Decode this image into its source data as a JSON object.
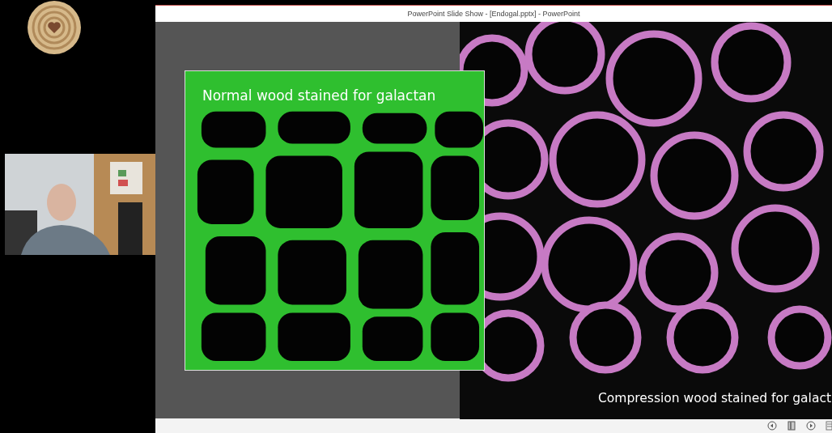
{
  "window": {
    "title": "PowerPoint Slide Show - [Endogal.pptx] - PowerPoint"
  },
  "slide": {
    "images": [
      {
        "kind": "picture",
        "caption": "Compression wood stained for galact"
      },
      {
        "kind": "picture",
        "caption": "Normal wood stained for galactan"
      }
    ]
  },
  "status_bar": {
    "buttons": [
      {
        "kind": "previous"
      },
      {
        "kind": "reading"
      },
      {
        "kind": "next"
      },
      {
        "kind": "menu"
      }
    ]
  }
}
